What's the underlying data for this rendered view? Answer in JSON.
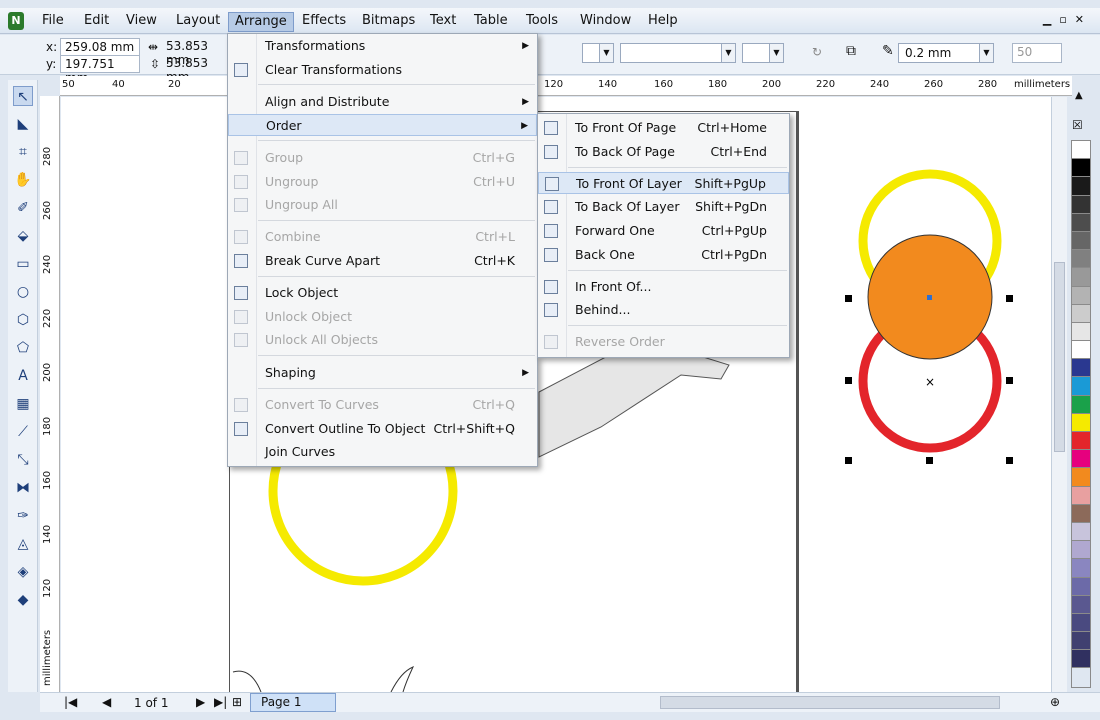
{
  "menubar": {
    "items": [
      "File",
      "Edit",
      "View",
      "Layout",
      "Arrange",
      "Effects",
      "Bitmaps",
      "Text",
      "Table",
      "Tools",
      "Window",
      "Help"
    ]
  },
  "propbar": {
    "x_label": "x:",
    "x_value": "259.08 mm",
    "y_label": "y:",
    "y_value": "197.751 mm",
    "w_value": "53.853 mm",
    "h_value": "53.853 mm",
    "outline_width": "0.2 mm",
    "spin_value": "50"
  },
  "ruler_top": {
    "ticks": [
      "50",
      "40",
      "20",
      "120",
      "140",
      "160",
      "180",
      "200",
      "220",
      "240",
      "260",
      "280"
    ],
    "unit": "millimeters"
  },
  "ruler_left": {
    "ticks": [
      "280",
      "260",
      "240",
      "220",
      "200",
      "180",
      "160",
      "140",
      "120"
    ],
    "unit": "millimeters"
  },
  "arrange_menu": {
    "items": [
      {
        "label": "Transformations",
        "shortcut": "",
        "submenu": true,
        "disabled": false
      },
      {
        "label": "Clear Transformations",
        "shortcut": "",
        "submenu": false,
        "disabled": false
      },
      {
        "label": "Align and Distribute",
        "shortcut": "",
        "submenu": true,
        "disabled": false
      },
      {
        "label": "Order",
        "shortcut": "",
        "submenu": true,
        "disabled": false
      },
      {
        "label": "Group",
        "shortcut": "Ctrl+G",
        "submenu": false,
        "disabled": true
      },
      {
        "label": "Ungroup",
        "shortcut": "Ctrl+U",
        "submenu": false,
        "disabled": true
      },
      {
        "label": "Ungroup All",
        "shortcut": "",
        "submenu": false,
        "disabled": true
      },
      {
        "label": "Combine",
        "shortcut": "Ctrl+L",
        "submenu": false,
        "disabled": true
      },
      {
        "label": "Break Curve Apart",
        "shortcut": "Ctrl+K",
        "submenu": false,
        "disabled": false
      },
      {
        "label": "Lock Object",
        "shortcut": "",
        "submenu": false,
        "disabled": false
      },
      {
        "label": "Unlock Object",
        "shortcut": "",
        "submenu": false,
        "disabled": true
      },
      {
        "label": "Unlock All Objects",
        "shortcut": "",
        "submenu": false,
        "disabled": true
      },
      {
        "label": "Shaping",
        "shortcut": "",
        "submenu": true,
        "disabled": false
      },
      {
        "label": "Convert To Curves",
        "shortcut": "Ctrl+Q",
        "submenu": false,
        "disabled": true
      },
      {
        "label": "Convert Outline To Object",
        "shortcut": "Ctrl+Shift+Q",
        "submenu": false,
        "disabled": false
      },
      {
        "label": "Join Curves",
        "shortcut": "",
        "submenu": false,
        "disabled": false
      }
    ]
  },
  "order_submenu": {
    "items": [
      {
        "label": "To Front Of Page",
        "shortcut": "Ctrl+Home",
        "disabled": false
      },
      {
        "label": "To Back Of Page",
        "shortcut": "Ctrl+End",
        "disabled": false
      },
      {
        "label": "To Front Of Layer",
        "shortcut": "Shift+PgUp",
        "disabled": false
      },
      {
        "label": "To Back Of Layer",
        "shortcut": "Shift+PgDn",
        "disabled": false
      },
      {
        "label": "Forward One",
        "shortcut": "Ctrl+PgUp",
        "disabled": false
      },
      {
        "label": "Back One",
        "shortcut": "Ctrl+PgDn",
        "disabled": false
      },
      {
        "label": "In Front Of...",
        "shortcut": "",
        "disabled": false
      },
      {
        "label": "Behind...",
        "shortcut": "",
        "disabled": false
      },
      {
        "label": "Reverse Order",
        "shortcut": "",
        "disabled": true
      }
    ]
  },
  "bottombar": {
    "page_count": "1 of 1",
    "page_tab": "Page 1"
  },
  "colors": {
    "yellow": "#f5ea00",
    "orange": "#f28a1e",
    "red": "#e3252b",
    "palette": [
      "#ffffff",
      "#000000",
      "#1a1a1a",
      "#333333",
      "#4d4d4d",
      "#666666",
      "#808080",
      "#999999",
      "#b3b3b3",
      "#cccccc",
      "#e6e6e6",
      "#ffffff",
      "#2a3890",
      "#1a9ad6",
      "#1aa14a",
      "#f5ea00",
      "#e3252b",
      "#e6007e",
      "#f28a1e",
      "#e8a0a0",
      "#8c6a5a",
      "#c8c4dc",
      "#b0a8d0",
      "#8a86c0",
      "#6c6aa8",
      "#5a5890",
      "#4a4a80",
      "#404070",
      "#303060"
    ]
  }
}
